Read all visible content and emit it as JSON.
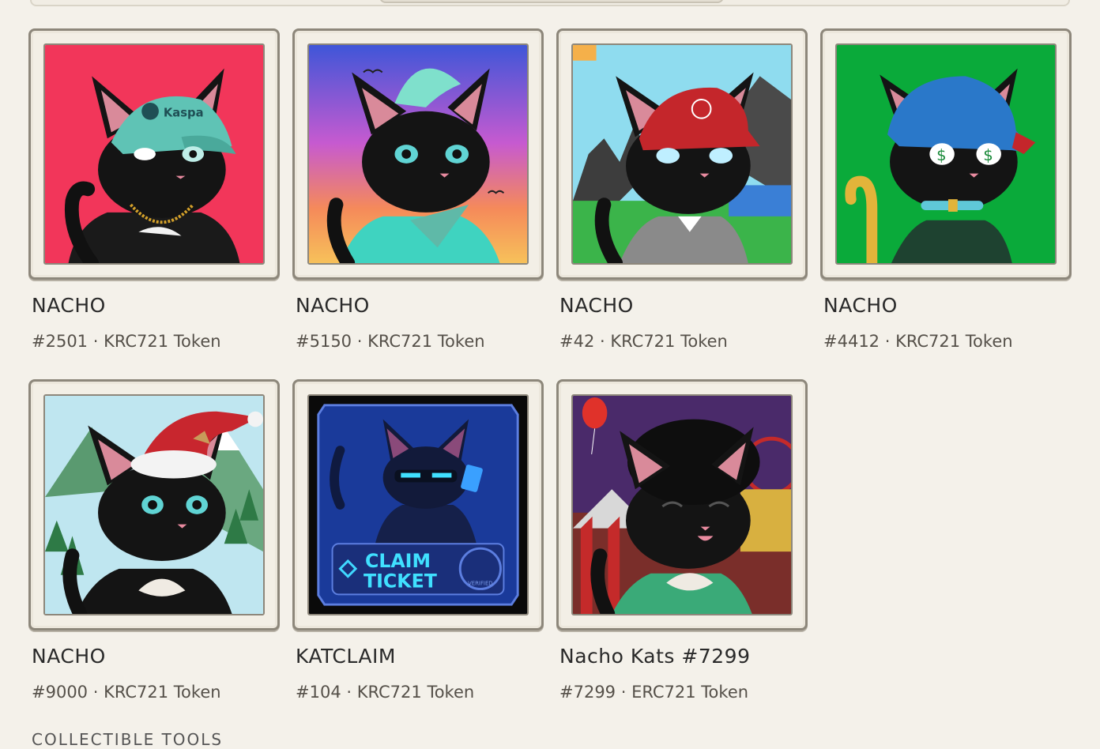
{
  "colors": {
    "page_bg": "#f4f1ea",
    "card_border": "#8d877b",
    "text": "#2a2a2a",
    "muted": "#555049"
  },
  "items": [
    {
      "name": "NACHO",
      "meta": "#2501 · KRC721 Token",
      "cap_text": "Kaspa"
    },
    {
      "name": "NACHO",
      "meta": "#5150 · KRC721 Token"
    },
    {
      "name": "NACHO",
      "meta": "#42 · KRC721 Token"
    },
    {
      "name": "NACHO",
      "meta": "#4412 · KRC721 Token"
    },
    {
      "name": "NACHO",
      "meta": "#9000 · KRC721 Token"
    },
    {
      "name": "KATCLAIM",
      "meta": "#104 · KRC721 Token",
      "ticket_line1": "CLAIM",
      "ticket_line2": "TICKET",
      "badge_text": "VERIFIED"
    },
    {
      "name": "Nacho Kats #7299",
      "meta": "#7299 · ERC721 Token"
    }
  ],
  "section": {
    "label": "COLLECTIBLE TOOLS"
  }
}
